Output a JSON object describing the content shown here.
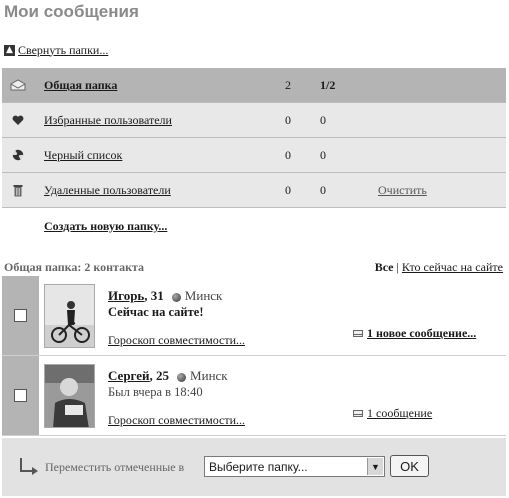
{
  "page": {
    "title": "Мои сообщения"
  },
  "collapse": {
    "label": "Свернуть папки..."
  },
  "folders": [
    {
      "icon": "envelope-open-icon",
      "name": "Общая папка",
      "count1": "2",
      "count2": "1/2",
      "action": "",
      "active": true
    },
    {
      "icon": "heart-icon",
      "name": "Избранные пользователи",
      "count1": "0",
      "count2": "0",
      "action": ""
    },
    {
      "icon": "radiation-icon",
      "name": "Черный список",
      "count1": "0",
      "count2": "0",
      "action": ""
    },
    {
      "icon": "trash-icon",
      "name": "Удаленные пользователи",
      "count1": "0",
      "count2": "0",
      "action": "Очистить"
    }
  ],
  "create_folder": {
    "label": "Создать новую папку..."
  },
  "list_header": {
    "summary": "Общая папка: 2 контакта",
    "all": "Все",
    "separator": "|",
    "online": "Кто сейчас на сайте"
  },
  "contacts": [
    {
      "name": "Игорь",
      "age": ", 31",
      "city": "Минск",
      "status": "Сейчас на сайте!",
      "horoscope": "Гороскоп совместимости...",
      "message": "1 новое сообщение..."
    },
    {
      "name": "Сергей",
      "age": ", 25",
      "city": "Минск",
      "status": "Был вчера в 18:40",
      "horoscope": "Гороскоп совместимости...",
      "message": "1 сообщение"
    }
  ],
  "move": {
    "label": "Переместить отмеченные в",
    "select_value": "Выберите папку...",
    "ok": "OK"
  }
}
